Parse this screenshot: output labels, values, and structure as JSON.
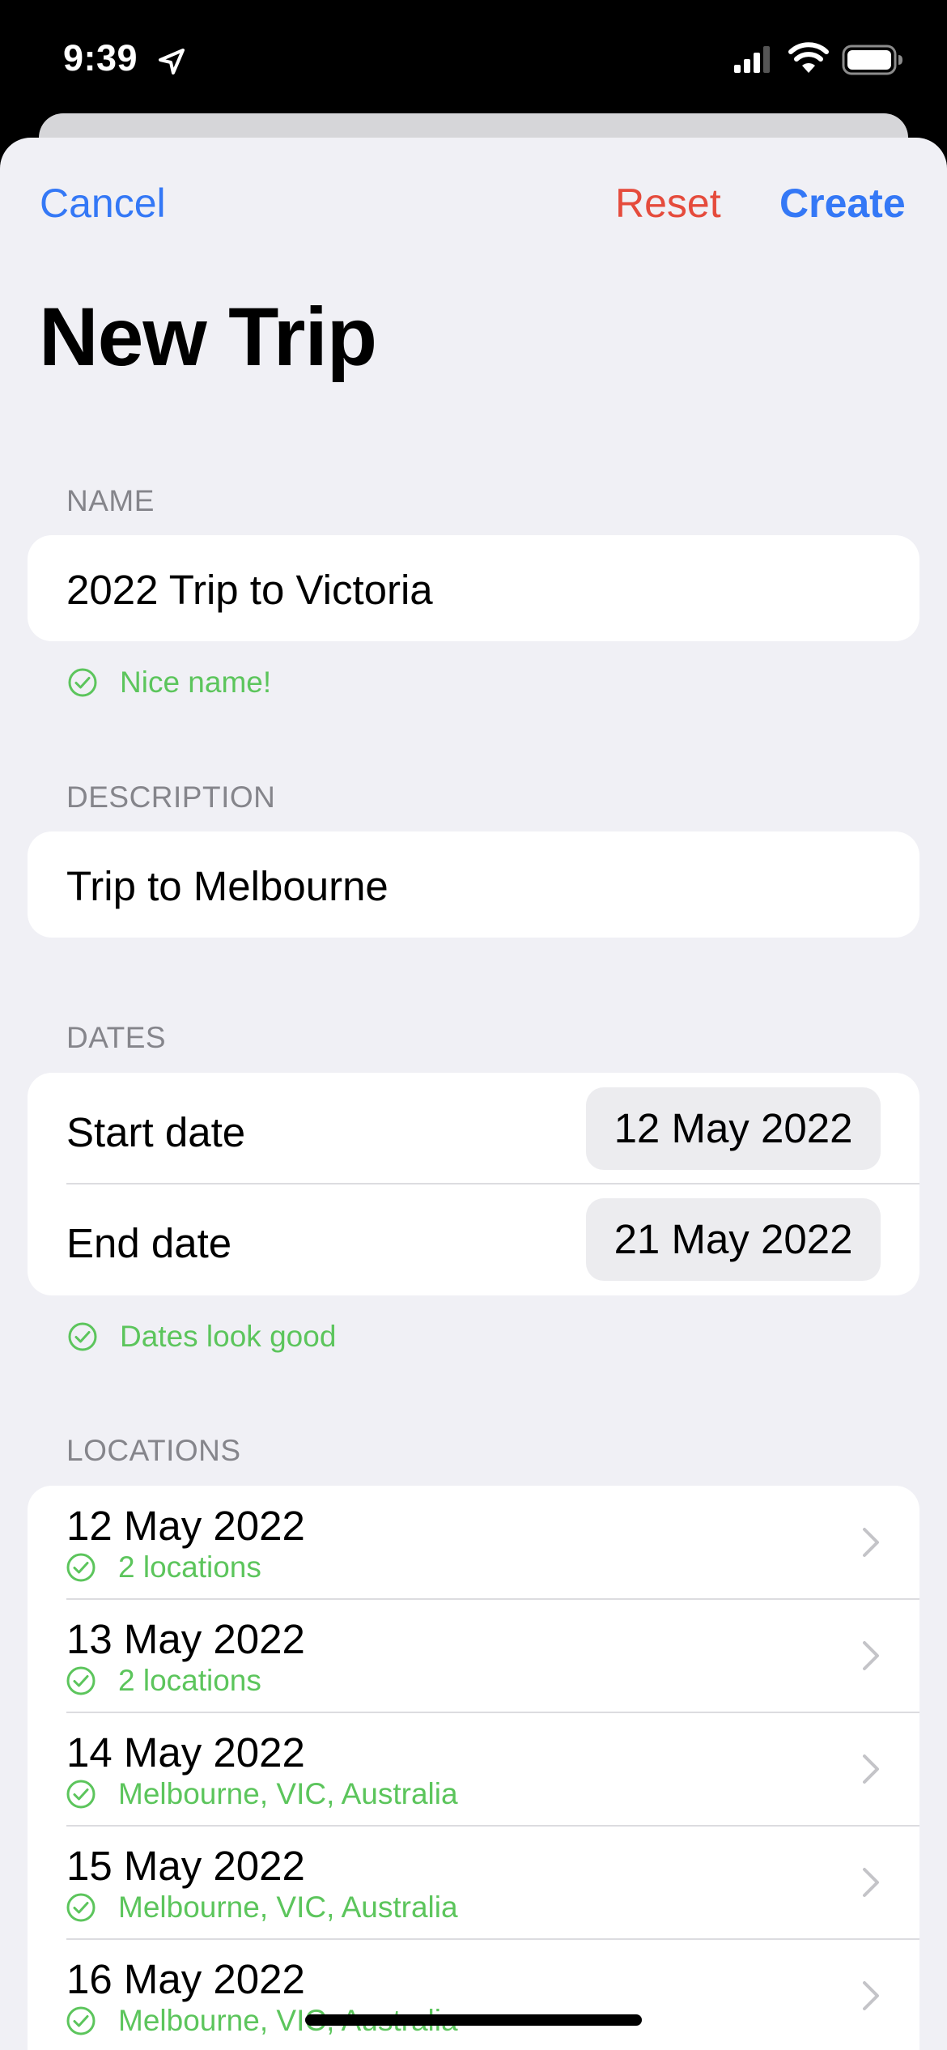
{
  "status_bar": {
    "time": "9:39"
  },
  "nav": {
    "cancel_label": "Cancel",
    "reset_label": "Reset",
    "create_label": "Create"
  },
  "page_title": "New Trip",
  "name_section": {
    "header": "NAME",
    "value": "2022 Trip to Victoria",
    "validation": "Nice name!"
  },
  "description_section": {
    "header": "DESCRIPTION",
    "value": "Trip to Melbourne"
  },
  "dates_section": {
    "header": "DATES",
    "start_label": "Start date",
    "start_value": "12 May 2022",
    "end_label": "End date",
    "end_value": "21 May 2022",
    "validation": "Dates look good"
  },
  "locations_section": {
    "header": "LOCATIONS",
    "items": [
      {
        "date": "12 May 2022",
        "detail": "2 locations"
      },
      {
        "date": "13 May 2022",
        "detail": "2 locations"
      },
      {
        "date": "14 May 2022",
        "detail": "Melbourne, VIC, Australia"
      },
      {
        "date": "15 May 2022",
        "detail": "Melbourne, VIC, Australia"
      },
      {
        "date": "16 May 2022",
        "detail": "Melbourne, VIC, Australia"
      }
    ]
  },
  "colors": {
    "accent": "#3478f6",
    "destructive": "#e54b3c",
    "success": "#5cc55c",
    "background": "#f0f0f5"
  }
}
